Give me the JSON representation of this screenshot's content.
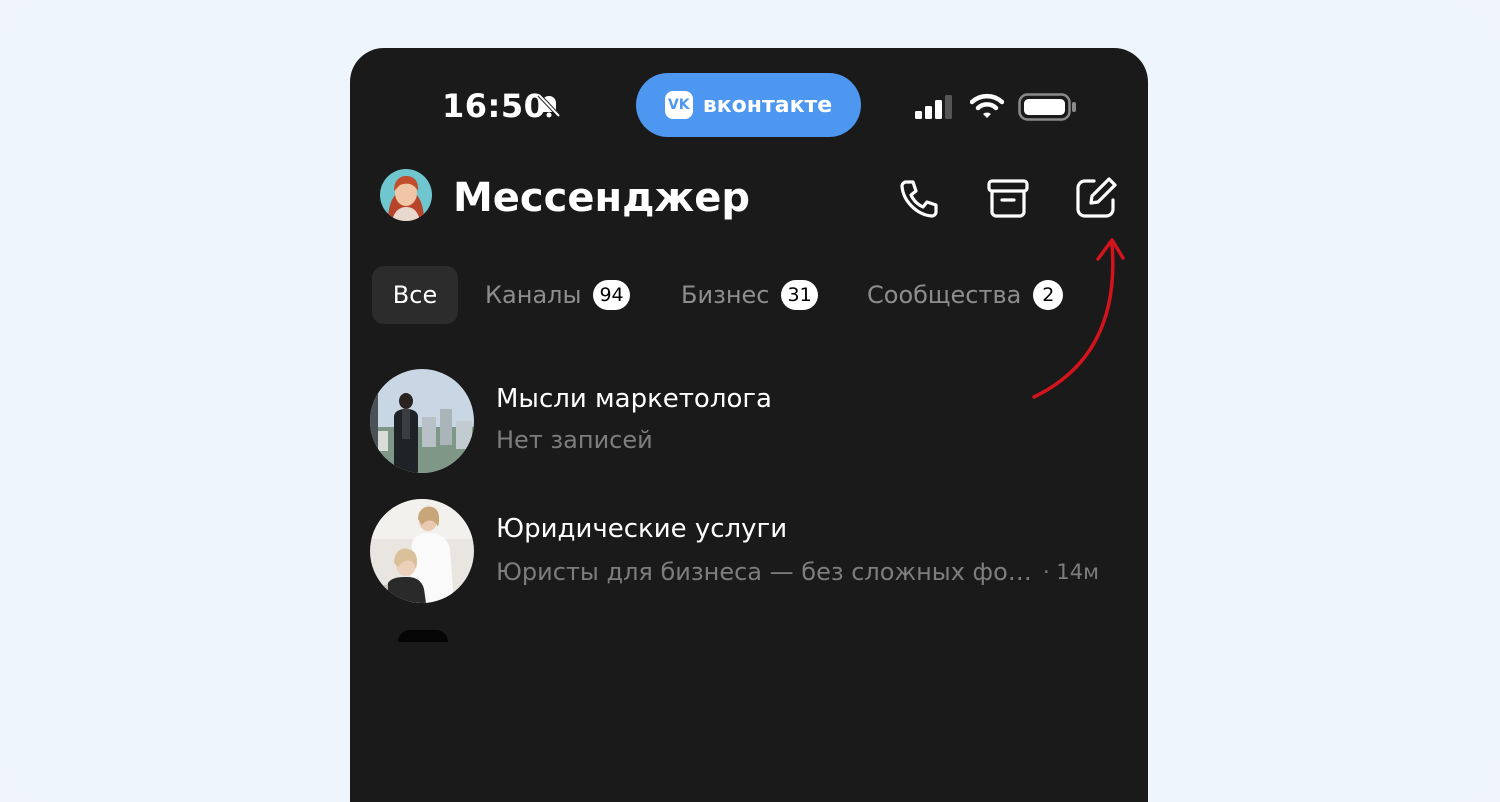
{
  "status_bar": {
    "time": "16:50",
    "island_label": "вконтакте",
    "logo_text": "VK",
    "icons": [
      "bell-off-icon",
      "signal-icon",
      "wifi-icon",
      "battery-icon"
    ]
  },
  "header": {
    "title": "Мессенджер",
    "icons": [
      "phone-icon",
      "archive-icon",
      "compose-icon"
    ]
  },
  "tabs": [
    {
      "label": "Все",
      "active": true
    },
    {
      "label": "Каналы",
      "count": "94"
    },
    {
      "label": "Бизнес",
      "count": "31"
    },
    {
      "label": "Сообщества",
      "count": "2"
    }
  ],
  "chats": [
    {
      "name": "Мысли маркетолога",
      "preview": "Нет записей",
      "time": ""
    },
    {
      "name": "Юридические услуги",
      "preview": "Юристы для бизнеса — без сложных фо…",
      "time": "· 14м"
    }
  ],
  "colors": {
    "background": "#eff5fd",
    "screen": "#1a1a1a",
    "accent": "#4d97f0",
    "annotation_arrow": "#d3141c"
  }
}
